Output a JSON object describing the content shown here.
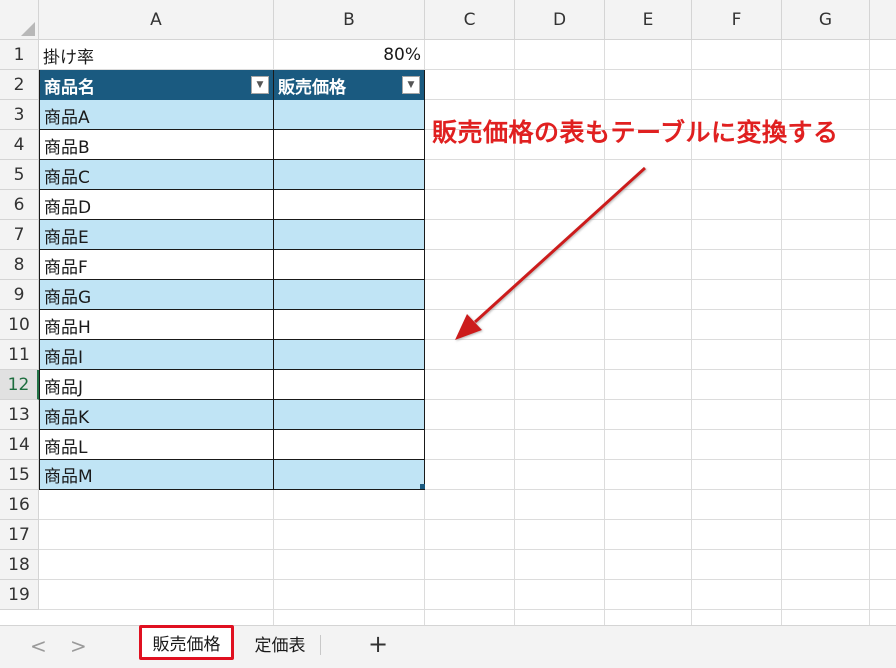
{
  "sheet": {
    "columns": [
      "A",
      "B",
      "C",
      "D",
      "E",
      "F",
      "G"
    ],
    "rows": [
      "1",
      "2",
      "3",
      "4",
      "5",
      "6",
      "7",
      "8",
      "9",
      "10",
      "11",
      "12",
      "13",
      "14",
      "15",
      "16",
      "17",
      "18",
      "19"
    ],
    "active_row": "12",
    "cell_a1": "掛け率",
    "cell_b1": "80%"
  },
  "table": {
    "headers": [
      "商品名",
      "販売価格"
    ],
    "filter_icon": "dropdown-arrow-icon",
    "items": [
      "商品A",
      "商品B",
      "商品C",
      "商品D",
      "商品E",
      "商品F",
      "商品G",
      "商品H",
      "商品I",
      "商品J",
      "商品K",
      "商品L",
      "商品M"
    ],
    "header_color": "#1a5a80",
    "band_color": "#c0e4f5"
  },
  "annotation": {
    "text": "販売価格の表もテーブルに変換する",
    "color": "#e02020"
  },
  "tabs": {
    "prev_icon": "chevron-left-icon",
    "next_icon": "chevron-right-icon",
    "prev_glyph": "<",
    "next_glyph": ">",
    "items": [
      {
        "label": "販売価格",
        "active": true
      },
      {
        "label": "定価表",
        "active": false
      }
    ],
    "add_glyph": "+",
    "highlight_color": "#e01020"
  }
}
